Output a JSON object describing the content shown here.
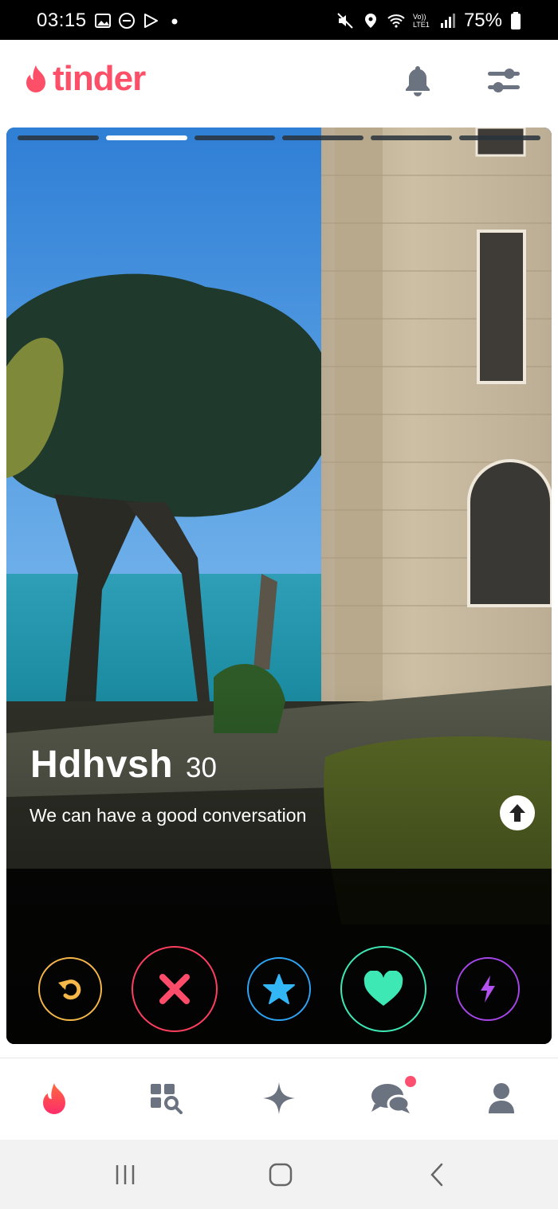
{
  "status_bar": {
    "time": "03:15",
    "battery": "75%",
    "left_icons": [
      "image-icon",
      "dnd-icon",
      "play-icon",
      "dot-icon"
    ],
    "right_icons": [
      "mute-icon",
      "location-icon",
      "wifi-icon",
      "lte-icon",
      "signal-icon",
      "battery-icon"
    ],
    "lte_label": "Vo)) LTE1"
  },
  "header": {
    "logo_text": "tinder",
    "brand_color": "#fd5068",
    "icons": [
      "bell-icon",
      "filter-sliders-icon"
    ]
  },
  "profile_card": {
    "photo_count": 6,
    "active_photo_index": 1,
    "name": "Hdhvsh",
    "age": "30",
    "bio": "We can have a good conversation"
  },
  "actions": [
    {
      "name": "rewind",
      "icon": "rewind-icon",
      "color": "#f5b748"
    },
    {
      "name": "nope",
      "icon": "x-icon",
      "color": "#fd3f5e"
    },
    {
      "name": "super-like",
      "icon": "star-icon",
      "color": "#2da4f4"
    },
    {
      "name": "like",
      "icon": "heart-icon",
      "color": "#3ee8b5"
    },
    {
      "name": "boost",
      "icon": "bolt-icon",
      "color": "#a646e8"
    }
  ],
  "bottom_nav": [
    {
      "name": "home",
      "icon": "flame-icon",
      "active": true
    },
    {
      "name": "explore",
      "icon": "explore-grid-icon",
      "active": false
    },
    {
      "name": "gold",
      "icon": "sparkle-icon",
      "active": false
    },
    {
      "name": "messages",
      "icon": "chat-icon",
      "active": false,
      "notification": true
    },
    {
      "name": "profile",
      "icon": "user-icon",
      "active": false
    }
  ],
  "system_nav": [
    "recents-icon",
    "home-icon",
    "back-icon"
  ]
}
